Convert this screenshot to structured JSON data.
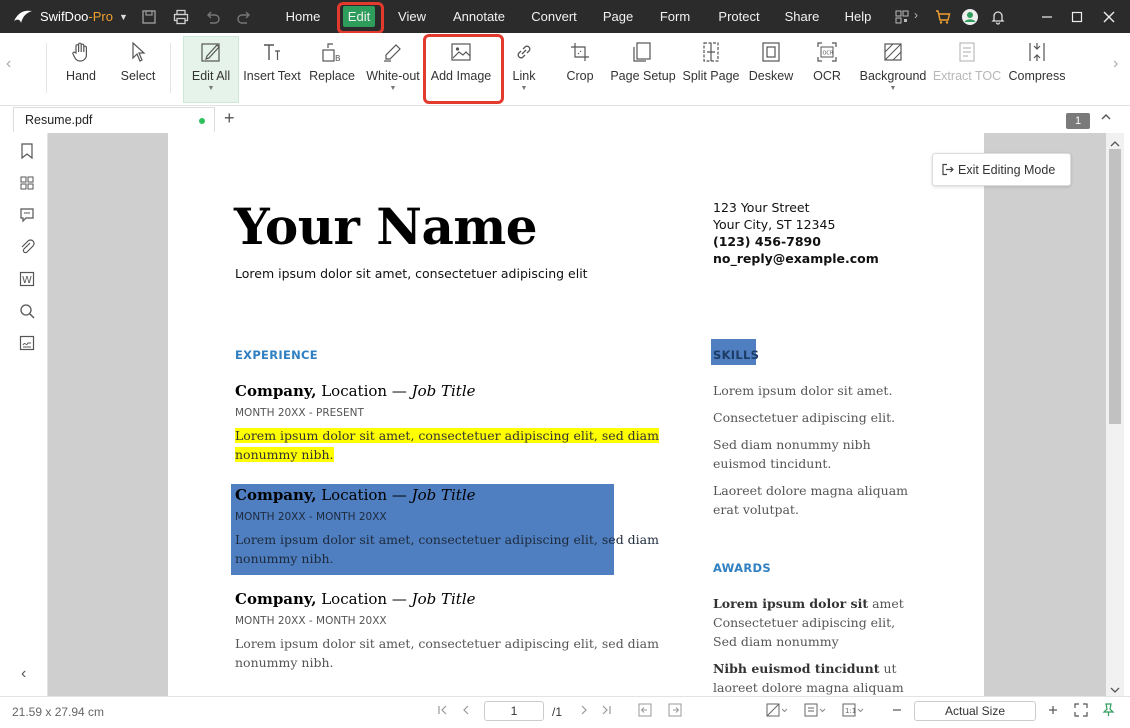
{
  "app": {
    "name": "SwifDoo",
    "edition": "-Pro"
  },
  "menu": {
    "items": [
      {
        "label": "Home"
      },
      {
        "label": "Edit"
      },
      {
        "label": "View"
      },
      {
        "label": "Annotate"
      },
      {
        "label": "Convert"
      },
      {
        "label": "Page"
      },
      {
        "label": "Form"
      },
      {
        "label": "Protect"
      },
      {
        "label": "Share"
      },
      {
        "label": "Help"
      }
    ],
    "active": "Edit"
  },
  "ribbon": {
    "tools": [
      {
        "label": "Hand",
        "icon": "hand-icon"
      },
      {
        "label": "Select",
        "icon": "cursor-icon"
      },
      {
        "label": "Edit All",
        "icon": "edit-all-icon"
      },
      {
        "label": "Insert Text",
        "icon": "insert-text-icon"
      },
      {
        "label": "Replace",
        "icon": "replace-icon"
      },
      {
        "label": "White-out",
        "icon": "white-out-icon"
      },
      {
        "label": "Add Image",
        "icon": "add-image-icon"
      },
      {
        "label": "Link",
        "icon": "link-icon"
      },
      {
        "label": "Crop",
        "icon": "crop-icon"
      },
      {
        "label": "Page Setup",
        "icon": "page-setup-icon"
      },
      {
        "label": "Split Page",
        "icon": "split-page-icon"
      },
      {
        "label": "Deskew",
        "icon": "deskew-icon"
      },
      {
        "label": "OCR",
        "icon": "ocr-icon"
      },
      {
        "label": "Background",
        "icon": "background-icon"
      },
      {
        "label": "Extract TOC",
        "icon": "extract-toc-icon"
      },
      {
        "label": "Compress",
        "icon": "compress-icon"
      }
    ]
  },
  "tabs": {
    "doc": "Resume.pdf",
    "add": "+",
    "page_badge": "1"
  },
  "document": {
    "name": "Your Name",
    "tagline": "Lorem ipsum dolor sit amet, consectetuer adipiscing elit",
    "address": [
      "123 Your Street",
      "Your City, ST 12345"
    ],
    "phone": "(123) 456-7890",
    "email": "no_reply@example.com",
    "exit_editing": "Exit Editing Mode",
    "experience_heading": "EXPERIENCE",
    "jobs": [
      {
        "company": "Company,",
        "location": " Location — ",
        "title": "Job Title",
        "dates": "MONTH 20XX - PRESENT",
        "desc1": "Lorem ipsum dolor sit amet, consectetuer adipiscing elit, sed diam",
        "desc2": "nonummy nibh."
      },
      {
        "company": "Company,",
        "location": " Location — ",
        "title": "Job Title",
        "dates": "MONTH 20XX - MONTH 20XX",
        "desc1": "Lorem ipsum dolor sit amet, consectetuer adipiscing elit, sed diam",
        "desc2": "nonummy nibh."
      },
      {
        "company": "Company,",
        "location": " Location — ",
        "title": "Job Title",
        "dates": "MONTH 20XX - MONTH 20XX",
        "desc1": "Lorem ipsum dolor sit amet, consectetuer adipiscing elit, sed diam",
        "desc2": "nonummy nibh."
      }
    ],
    "skills_heading": "SKILLS",
    "skills": [
      [
        "Lorem ipsum dolor sit amet."
      ],
      [
        "Consectetuer adipiscing elit."
      ],
      [
        "Sed diam nonummy nibh",
        "euismod tincidunt."
      ],
      [
        "Laoreet dolore magna aliquam",
        "erat volutpat."
      ]
    ],
    "awards_heading": "AWARDS",
    "awards": [
      {
        "bold": "Lorem ipsum dolor sit",
        "rest": " amet",
        "lines": [
          "Consectetuer adipiscing elit,",
          "Sed diam nonummy"
        ]
      },
      {
        "bold": "Nibh euismod tincidunt",
        "rest": " ut",
        "lines": [
          "laoreet dolore magna aliquam"
        ]
      }
    ]
  },
  "status": {
    "dimensions": "21.59 x 27.94 cm",
    "page_input": "1",
    "page_total": "/1",
    "zoom": "Actual Size"
  },
  "colors": {
    "accent_green": "#2e9d5b",
    "highlight_yellow": "#ffff00",
    "selection_blue": "#4f7fc0",
    "heading_blue": "#2f7fc1",
    "callout_red": "#e23b2e"
  }
}
